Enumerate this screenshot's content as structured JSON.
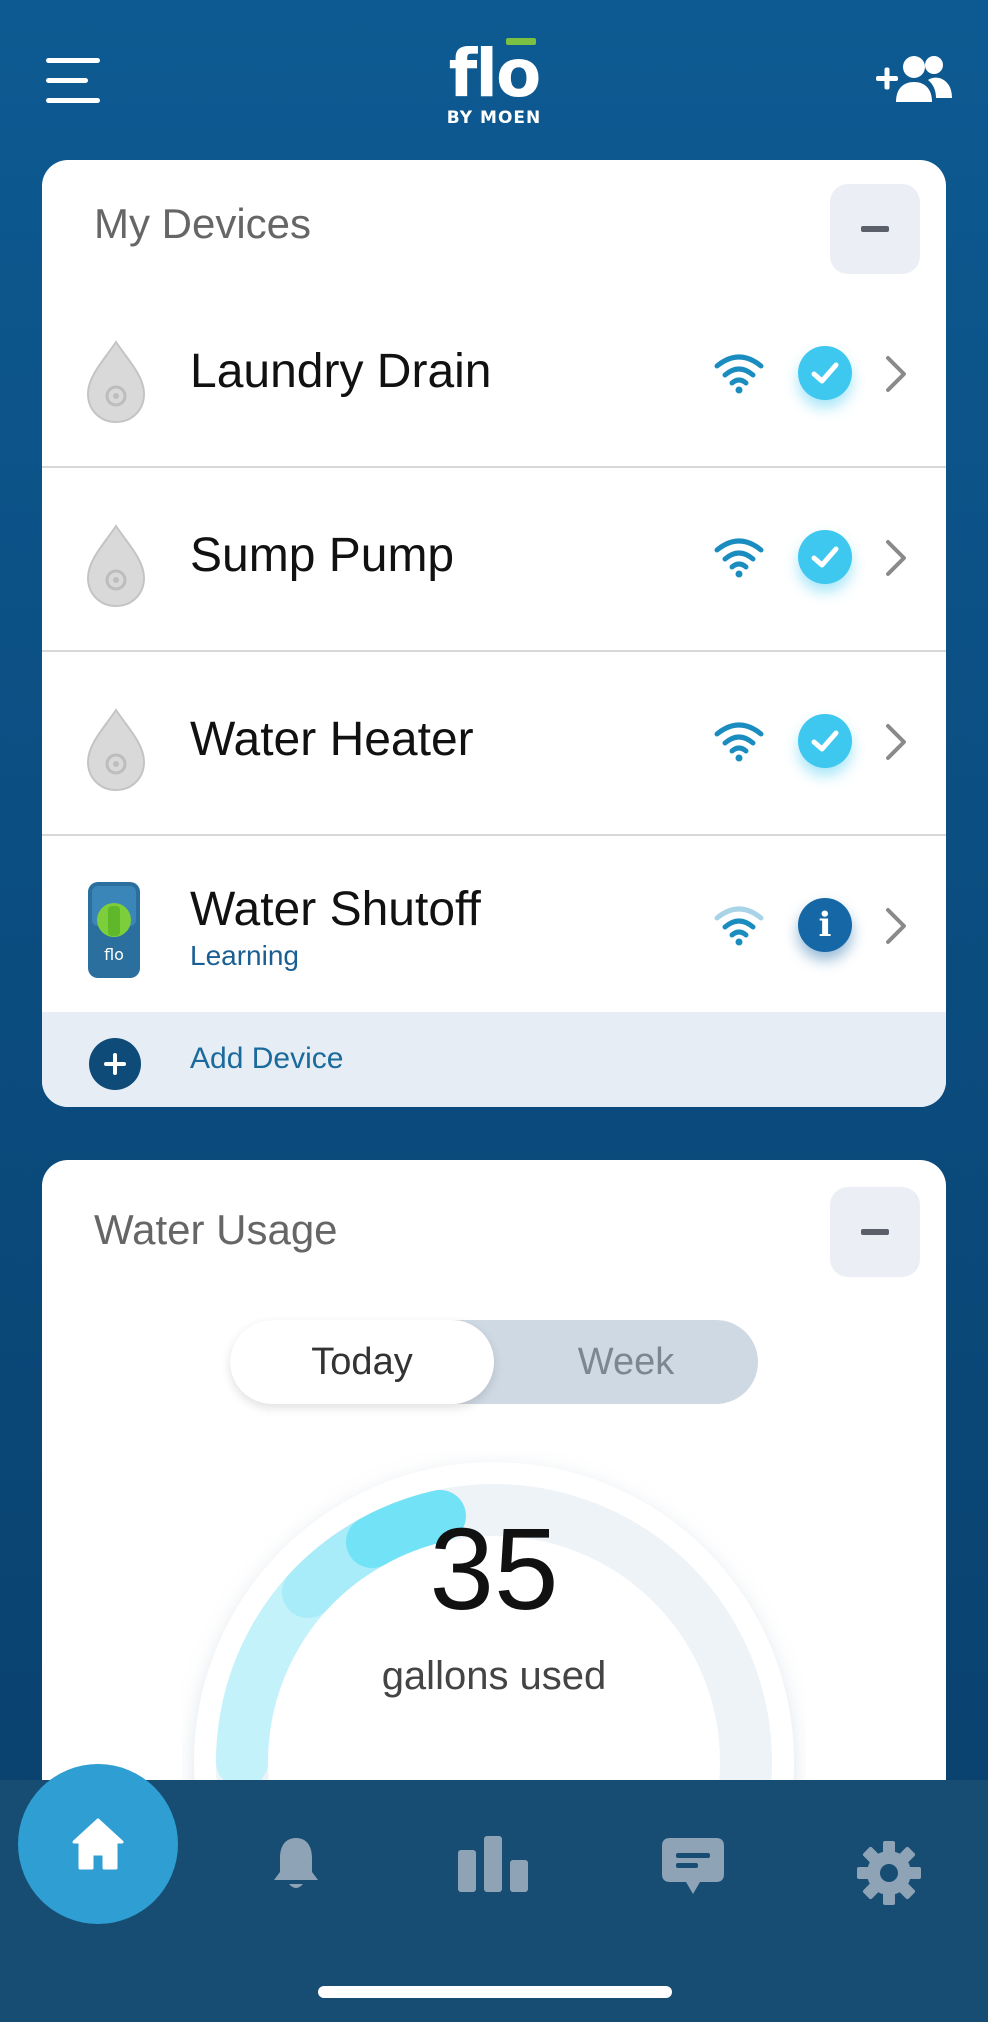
{
  "header": {
    "logo_main": "flo",
    "logo_sub": "BY MOEN",
    "menu_icon": "hamburger-menu-icon",
    "add_user_icon": "add-user-icon"
  },
  "devices": {
    "title": "My Devices",
    "items": [
      {
        "name": "Laundry Drain",
        "subtitle": "",
        "status": "check",
        "icon": "water-drop-sensor-icon"
      },
      {
        "name": "Sump Pump",
        "subtitle": "",
        "status": "check",
        "icon": "water-drop-sensor-icon"
      },
      {
        "name": "Water Heater",
        "subtitle": "",
        "status": "check",
        "icon": "water-drop-sensor-icon"
      },
      {
        "name": "Water Shutoff",
        "subtitle": "Learning",
        "status": "info",
        "icon": "shutoff-valve-icon"
      }
    ],
    "info_glyph": "i",
    "add_label": "Add Device"
  },
  "usage": {
    "title": "Water Usage",
    "tabs": [
      "Today",
      "Week"
    ],
    "selected_tab": "Today",
    "value": "35",
    "unit": "gallons used"
  },
  "nav": [
    "home-icon",
    "bell-icon",
    "bar-chart-icon",
    "chat-icon",
    "gear-icon"
  ],
  "colors": {
    "background": "#0d5a92",
    "accent_cyan": "#3ec8ef",
    "info_blue": "#1567a5",
    "nav_bg": "#174d73",
    "home_active": "#2f9fd3"
  }
}
